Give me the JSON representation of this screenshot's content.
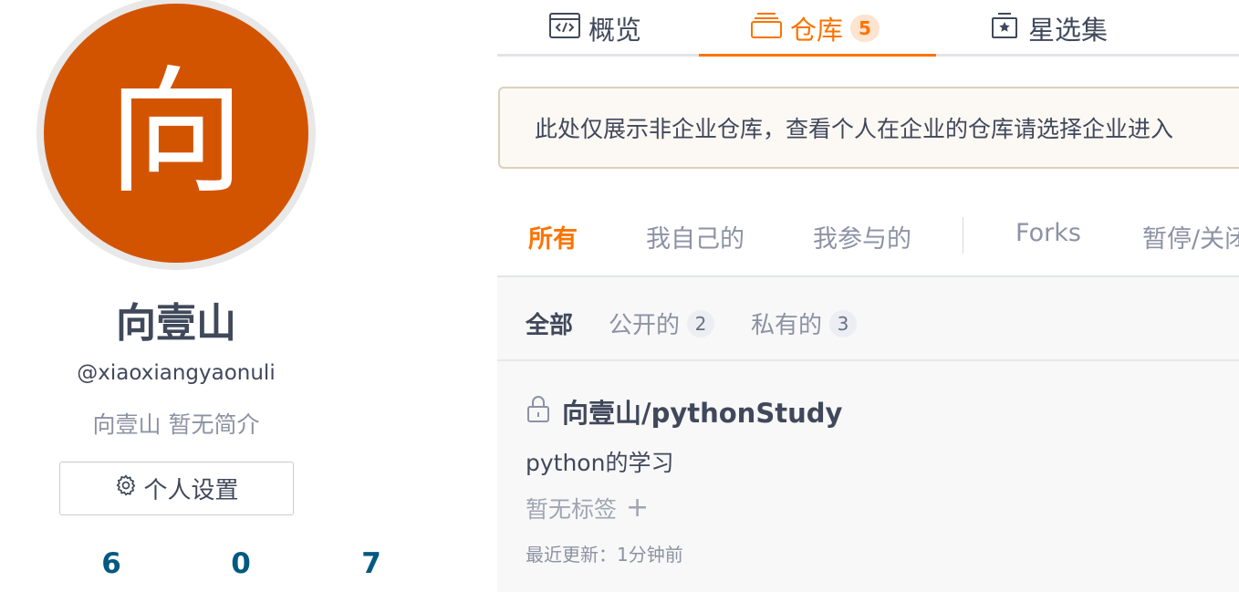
{
  "profile": {
    "avatar_char": "向",
    "avatar_color": "#d35400",
    "name": "向壹山",
    "handle": "@xiaoxiangyaonuli",
    "bio": "向壹山 暂无简介",
    "settings_label": "个人设置",
    "stats": [
      "6",
      "0",
      "7"
    ]
  },
  "tabs": [
    {
      "label": "概览",
      "icon": "code-window-icon",
      "active": false
    },
    {
      "label": "仓库",
      "icon": "stack-icon",
      "active": true,
      "count": "5"
    },
    {
      "label": "星选集",
      "icon": "star-box-icon",
      "active": false
    }
  ],
  "notice": "此处仅展示非企业仓库，查看个人在企业的仓库请选择企业进入",
  "filters": [
    "所有",
    "我自己的",
    "我参与的",
    "Forks",
    "暂停/关闭"
  ],
  "subfilters": [
    {
      "label": "全部"
    },
    {
      "label": "公开的",
      "count": "2"
    },
    {
      "label": "私有的",
      "count": "3"
    }
  ],
  "repo": {
    "title": "向壹山/pythonStudy",
    "description": "python的学习",
    "tags": "暂无标签",
    "add_tag": "+",
    "updated": "最近更新：1分钟前"
  },
  "colors": {
    "accent": "#fe7300",
    "stat": "#005980",
    "text": "#40485b"
  }
}
